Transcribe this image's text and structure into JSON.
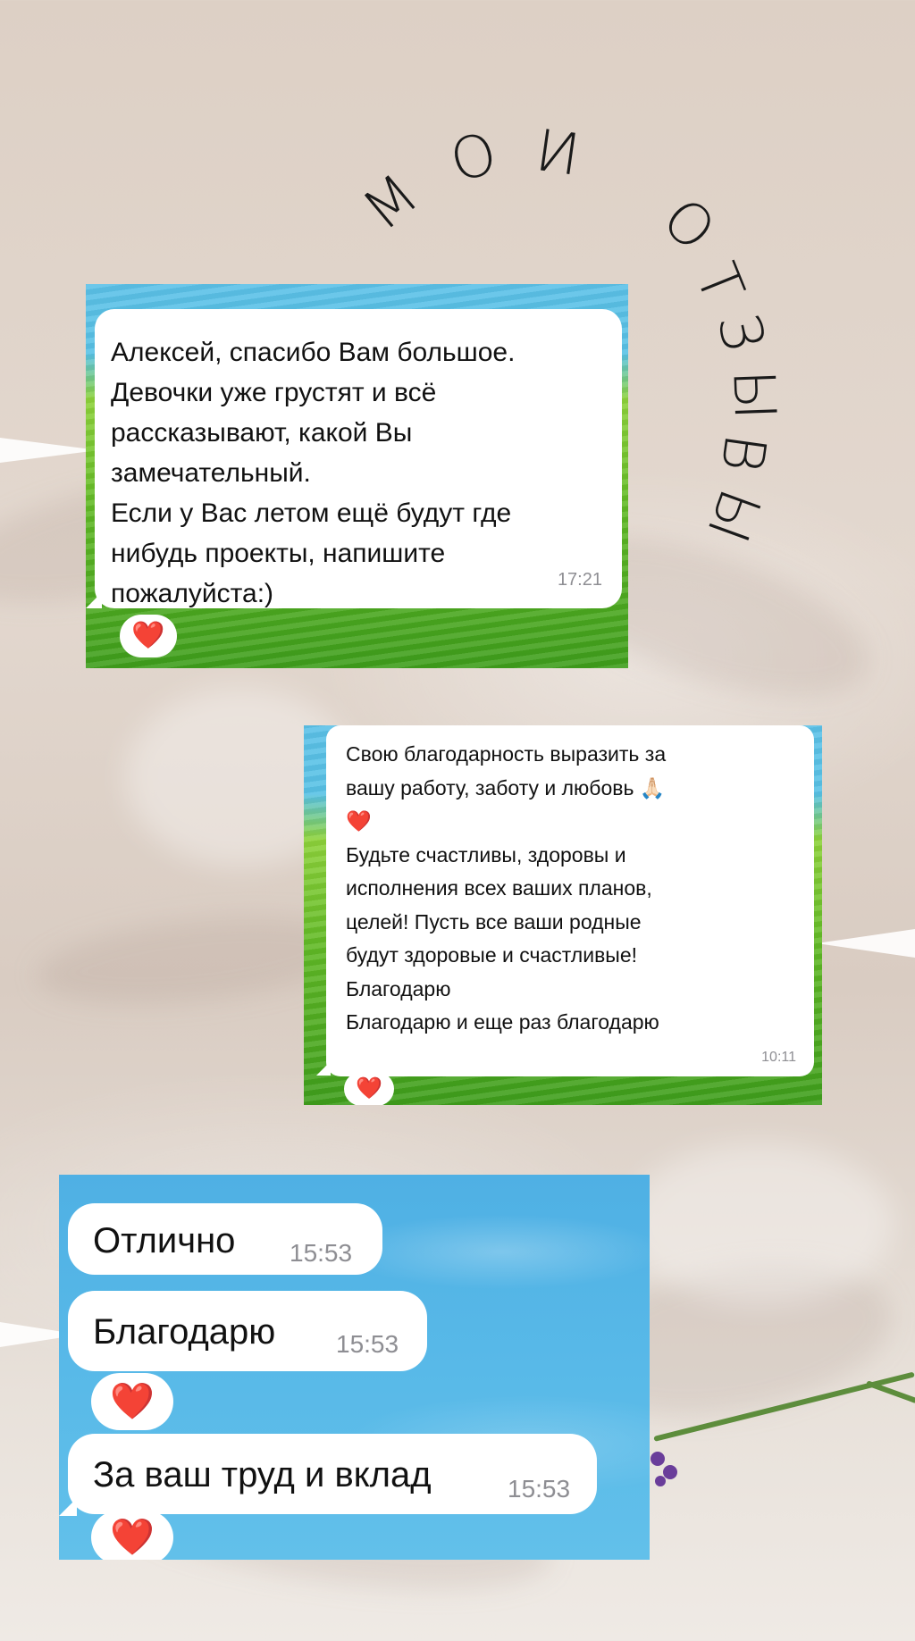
{
  "title_line1": [
    "М",
    "О",
    "И"
  ],
  "title_line2": [
    "О",
    "Т",
    "З",
    "Ы",
    "В",
    "Ы"
  ],
  "review1": {
    "text": "Алексей, спасибо Вам большое.\nДевочки уже грустят и всё\nрассказывают, какой Вы\nзамечательный.\nЕсли у Вас летом ещё будут где\nнибудь проекты, напишите\nпожалуйста:)",
    "time": "17:21",
    "reaction": "❤️"
  },
  "review2": {
    "text": "Свою благодарность выразить за\nвашу работу, заботу и любовь 🙏🏻\n❤️\nБудьте счастливы, здоровы и\nисполнения всех ваших планов,\nцелей! Пусть все ваши родные\nбудут здоровые и счастливые!\nБлагодарю\nБлагодарю и еще раз благодарю",
    "time": "10:11",
    "reaction": "❤️"
  },
  "review3": {
    "messages": [
      {
        "text": "Отлично",
        "time": "15:53"
      },
      {
        "text": "Благодарю",
        "time": "15:53",
        "reaction": "❤️"
      },
      {
        "text": "За ваш труд и вклад",
        "time": "15:53",
        "reaction": "❤️"
      }
    ]
  }
}
